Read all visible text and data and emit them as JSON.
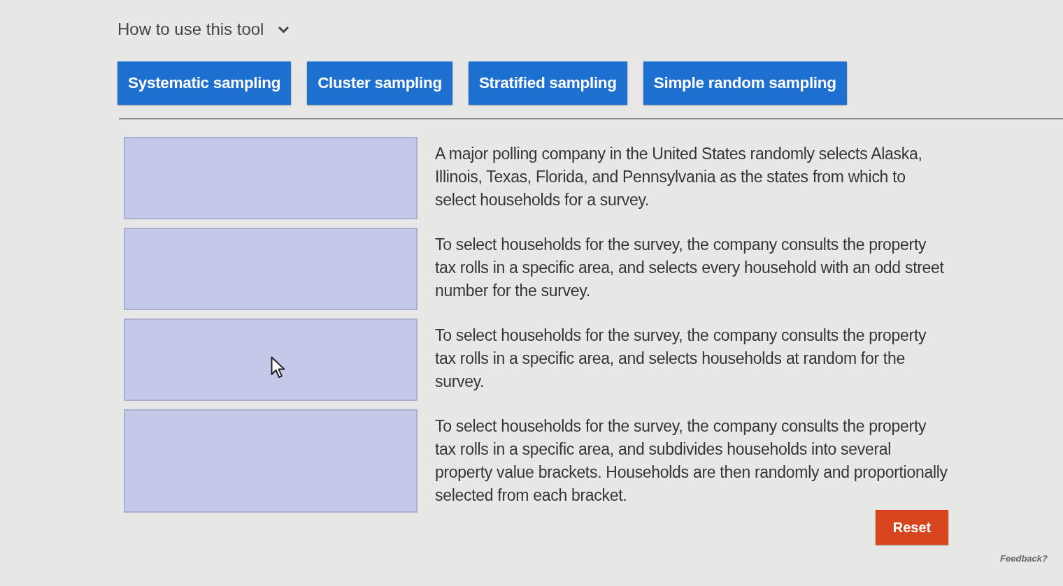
{
  "help": {
    "label": "How to use this tool",
    "expanded": false
  },
  "choices": [
    {
      "label": "Systematic sampling"
    },
    {
      "label": "Cluster sampling"
    },
    {
      "label": "Stratified sampling"
    },
    {
      "label": "Simple random sampling"
    }
  ],
  "rows": [
    {
      "description": "A major polling company in the United States randomly selects Alaska, Illinois, Texas, Florida, and Pennsylvania as the states from which to select households for a survey."
    },
    {
      "description": "To select households for the survey, the company consults the property tax rolls in a specific area, and selects every household with an odd street number for the survey."
    },
    {
      "description": "To select households for the survey, the company consults the property tax rolls in a specific area, and selects households at random for the survey.",
      "pointer": true
    },
    {
      "description": "To select households for the survey, the company consults the property tax rolls in a specific area, and subdivides households into several property value brackets. Households are then randomly and proportionally selected from each bracket."
    }
  ],
  "reset": {
    "label": "Reset"
  },
  "feedback": {
    "label": "Feedback?"
  }
}
